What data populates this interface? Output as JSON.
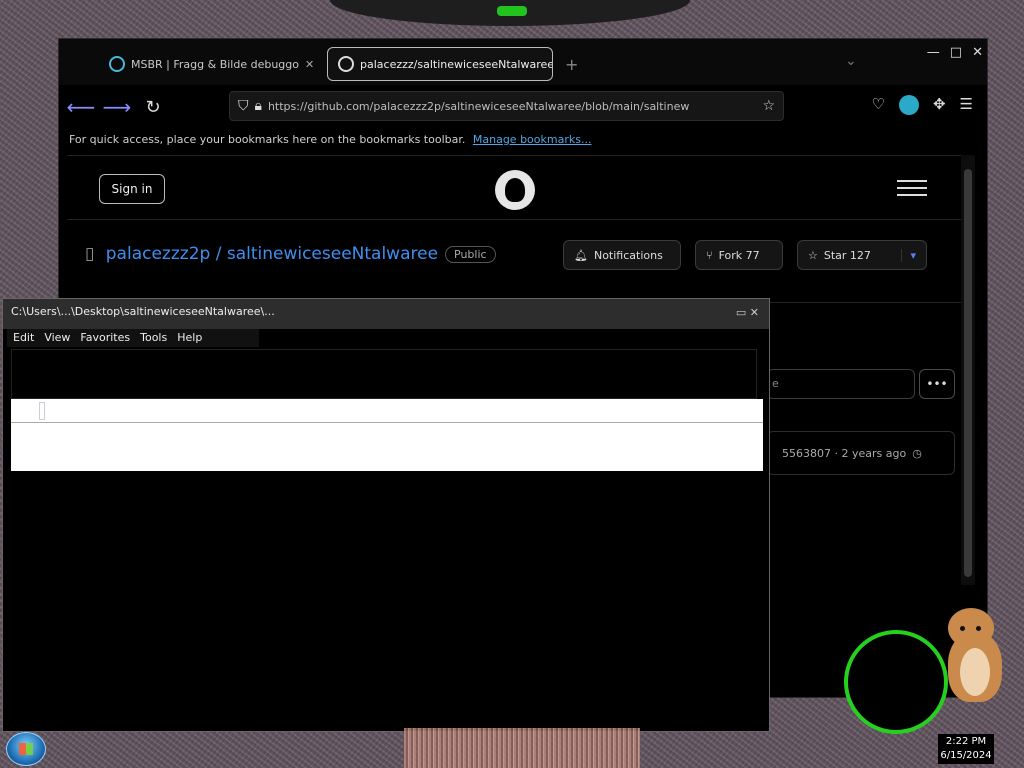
{
  "browser": {
    "tabs": [
      {
        "label": "MSBR | Fragg & Bilde debuggo"
      },
      {
        "label": "palacezzz/saltinewiceseeNtalwaree"
      }
    ],
    "newtab_symbol": "+",
    "window_controls": {
      "minimize": "—",
      "maximize": "□",
      "close": "✕"
    },
    "url": "https://github.com/palacezzz2p/saltinewiceseeNtalwaree/blob/main/saltinew",
    "bookmarks_hint": "For quick access, place your bookmarks here on the bookmarks toolbar.",
    "bookmarks_link": "Manage bookmarks..."
  },
  "github": {
    "signin_label": "Sign in",
    "repo_title": "palacezzz2p / saltinewiceseeNtalwaree",
    "visibility": "Public",
    "notifications_label": "Notifications",
    "fork_label": "Fork 77",
    "star_label": "Star 127",
    "branch_placeholder": "e",
    "more_symbol": "•••",
    "commit_info": "5563807 · 2 years ago"
  },
  "ie_window": {
    "title": "C:\\Users\\...\\Desktop\\saltinewiceseeNtalwaree\\...",
    "menu": [
      "Edit",
      "View",
      "Favorites",
      "Tools",
      "Help"
    ]
  },
  "taskbar": {
    "time": "2:22 PM",
    "date": "6/15/2024"
  },
  "colors": {
    "accent_green": "#25d01f",
    "link_blue": "#3f8ff0",
    "nav_arrow": "#8a8dff"
  }
}
